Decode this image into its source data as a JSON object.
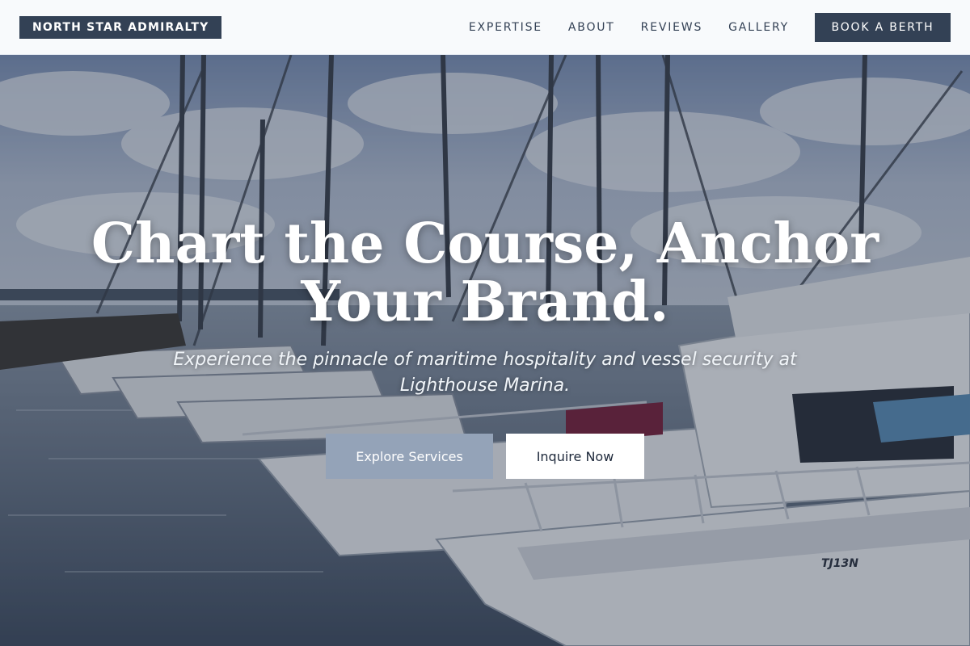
{
  "header": {
    "brand": "NORTH STAR ADMIRALTY",
    "nav": [
      {
        "label": "EXPERTISE"
      },
      {
        "label": "ABOUT"
      },
      {
        "label": "REVIEWS"
      },
      {
        "label": "GALLERY"
      }
    ],
    "cta_label": "BOOK A BERTH"
  },
  "hero": {
    "headline_line1": "Chart the Course, Anchor",
    "headline_line2": "Your Brand.",
    "subheadline_line1": "Experience the pinnacle of maritime hospitality and vessel security at",
    "subheadline_line2": "Lighthouse Marina.",
    "primary_button": "Explore Services",
    "secondary_button": "Inquire Now",
    "hull_marking": "TJ13N"
  },
  "colors": {
    "brand_dark": "#334155",
    "header_bg": "#f8fafc",
    "explore_button": "#94a3b8",
    "inquire_button": "#ffffff"
  }
}
